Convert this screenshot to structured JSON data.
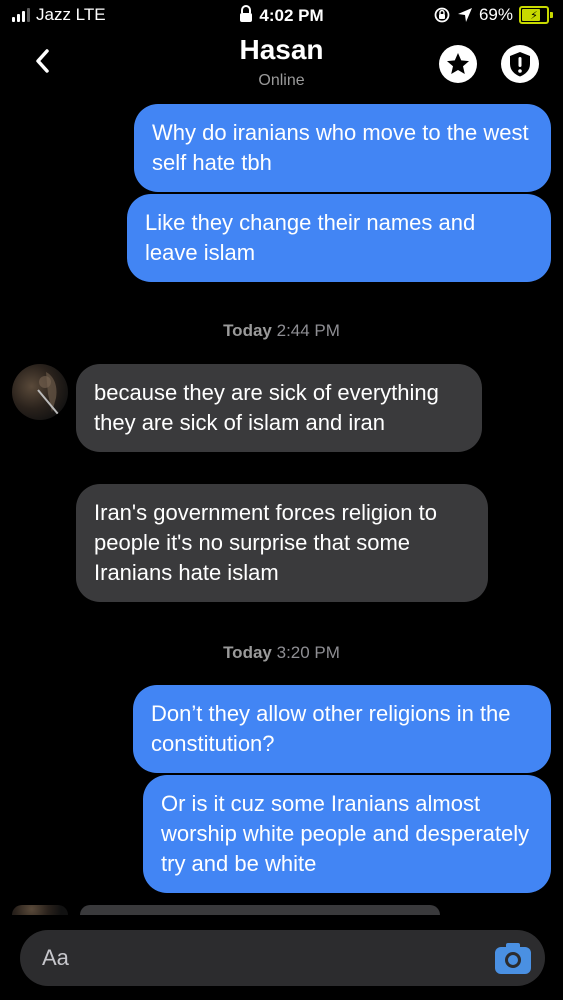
{
  "status_bar": {
    "carrier": "Jazz LTE",
    "time": "4:02 PM",
    "battery": "69%"
  },
  "header": {
    "title": "Hasan",
    "status": "Online"
  },
  "messages": [
    {
      "side": "out",
      "text": "Why do iranians who move to the west self hate tbh"
    },
    {
      "side": "out",
      "text": "Like they change their names and leave islam"
    },
    {
      "side": "time",
      "day": "Today",
      "time": "2:44 PM"
    },
    {
      "side": "in",
      "text": "because they are sick of everything they are sick of islam and iran"
    },
    {
      "side": "in",
      "text": "Iran's government forces religion to people it's no surprise that some Iranians hate islam"
    },
    {
      "side": "time",
      "day": "Today",
      "time": "3:20 PM"
    },
    {
      "side": "out",
      "text": "Don’t they allow other religions in the constitution?"
    },
    {
      "side": "out",
      "text": "Or is it cuz some Iranians almost worship white people and desperately try and be white"
    }
  ],
  "composer": {
    "placeholder": "Aa"
  },
  "colors": {
    "outgoing_bubble": "#4285f4",
    "incoming_bubble": "#3a3a3c",
    "battery": "#c8d900"
  }
}
